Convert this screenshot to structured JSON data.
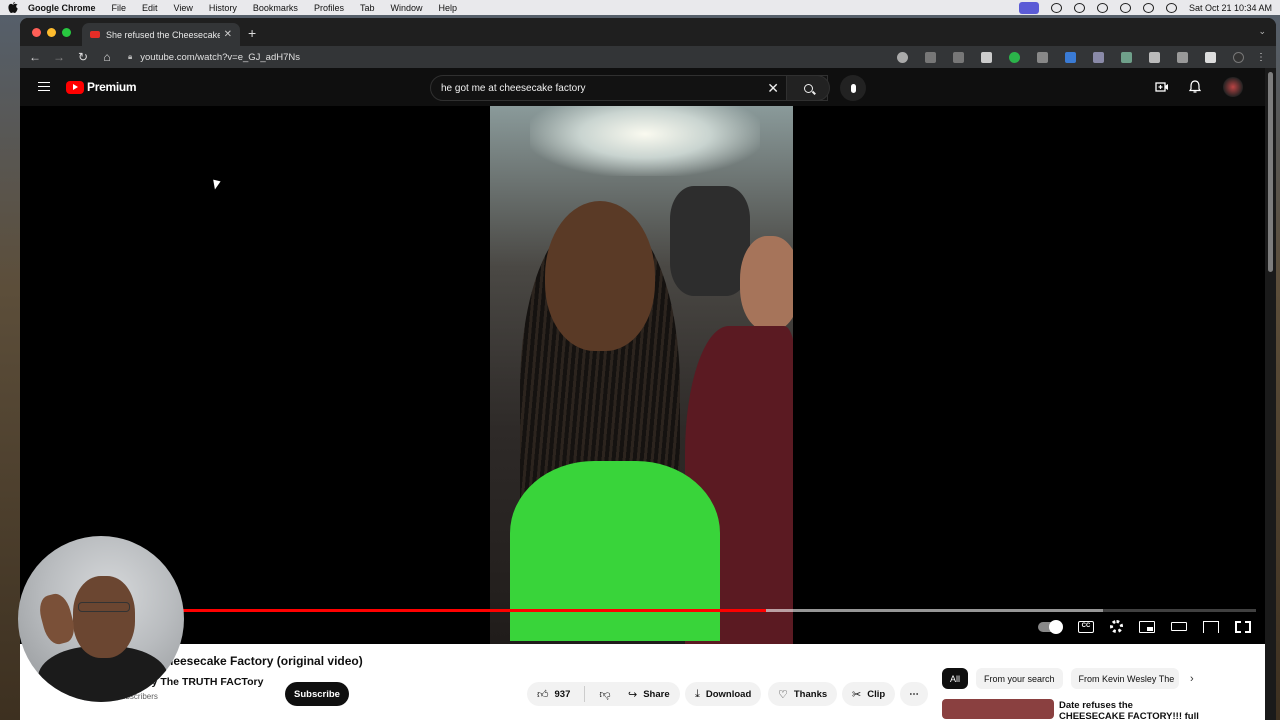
{
  "menubar": {
    "app": "Google Chrome",
    "items": [
      "File",
      "Edit",
      "View",
      "History",
      "Bookmarks",
      "Profiles",
      "Tab",
      "Window",
      "Help"
    ],
    "clock": "Sat Oct 21  10:34 AM"
  },
  "browser": {
    "tab_title": "She refused the Cheesecake Factory (original video) - YouTube",
    "url": "youtube.com/watch?v=e_GJ_adH7Ns"
  },
  "youtube": {
    "logo_text": "Premium",
    "search_query": "he got me at cheesecake factory"
  },
  "player": {
    "played_fraction": 0.6,
    "loaded_fraction": 0.875,
    "cc_label": "CC"
  },
  "video": {
    "title": "heesecake Factory (original video)",
    "channel": "sley The TRUTH FACTory",
    "subscribers": "subscribers",
    "subscribe_label": "Subscribe",
    "likes": "937",
    "share_label": "Share",
    "download_label": "Download",
    "thanks_label": "Thanks",
    "clip_label": "Clip"
  },
  "related": {
    "chips": [
      "All",
      "From your search",
      "From Kevin Wesley The"
    ],
    "first_title": "Date refuses the CHEESECAKE FACTORY!!! full exclusive"
  }
}
